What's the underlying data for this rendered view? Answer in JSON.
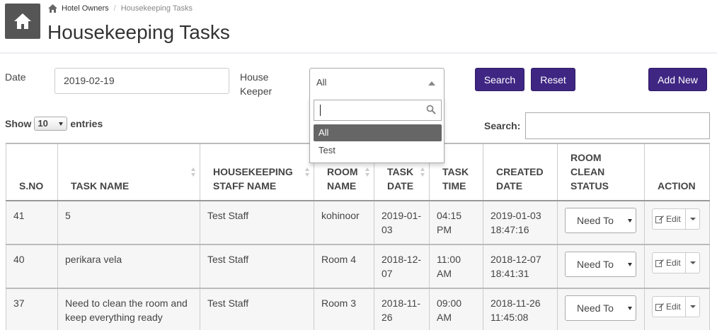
{
  "breadcrumb": {
    "home": "Hotel Owners",
    "current": "Housekeeping Tasks"
  },
  "page_title": "Housekeeping Tasks",
  "filters": {
    "date_label": "Date",
    "date_value": "2019-02-19",
    "keeper_label_1": "House",
    "keeper_label_2": "Keeper",
    "keeper_selected": "All",
    "keeper_options": [
      "All",
      "Test"
    ],
    "search_button": "Search",
    "reset_button": "Reset",
    "add_button": "Add New"
  },
  "table_controls": {
    "show_label": "Show",
    "page_length": "10",
    "entries_label": "entries",
    "search_label": "Search:"
  },
  "columns": [
    {
      "line1": "",
      "line2": "",
      "line3": "S.NO"
    },
    {
      "line1": "",
      "line2": "",
      "line3": "TASK NAME"
    },
    {
      "line1": "",
      "line2": "HOUSEKEEPING",
      "line3": "STAFF NAME"
    },
    {
      "line1": "",
      "line2": "ROOM",
      "line3": "NAME"
    },
    {
      "line1": "",
      "line2": "TASK",
      "line3": "DATE"
    },
    {
      "line1": "",
      "line2": "TASK",
      "line3": "TIME"
    },
    {
      "line1": "",
      "line2": "CREATED",
      "line3": "DATE"
    },
    {
      "line1": "ROOM",
      "line2": "CLEAN",
      "line3": "STATUS"
    },
    {
      "line1": "",
      "line2": "",
      "line3": "ACTION"
    }
  ],
  "rows": [
    {
      "sno": "41",
      "task": "5",
      "staff": "Test Staff",
      "room": "kohinoor",
      "task_date": "2019-01-03",
      "task_time": "04:15 PM",
      "created": "2019-01-03 18:47:16",
      "status": "Need To",
      "action": "Edit"
    },
    {
      "sno": "40",
      "task": "perikara vela",
      "staff": "Test Staff",
      "room": "Room 4",
      "task_date": "2018-12-07",
      "task_time": "11:00 AM",
      "created": "2018-12-07 18:41:31",
      "status": "Need To",
      "action": "Edit"
    },
    {
      "sno": "37",
      "task": "Need to clean the room and keep everything ready",
      "staff": "Test Staff",
      "room": "Room 3",
      "task_date": "2018-11-26",
      "task_time": "09:00 AM",
      "created": "2018-11-26 11:45:08",
      "status": "Need To",
      "action": "Edit"
    }
  ],
  "colors": {
    "primary": "#3f2683",
    "home_box": "#555555",
    "row_bg": "#f6f6f6"
  }
}
